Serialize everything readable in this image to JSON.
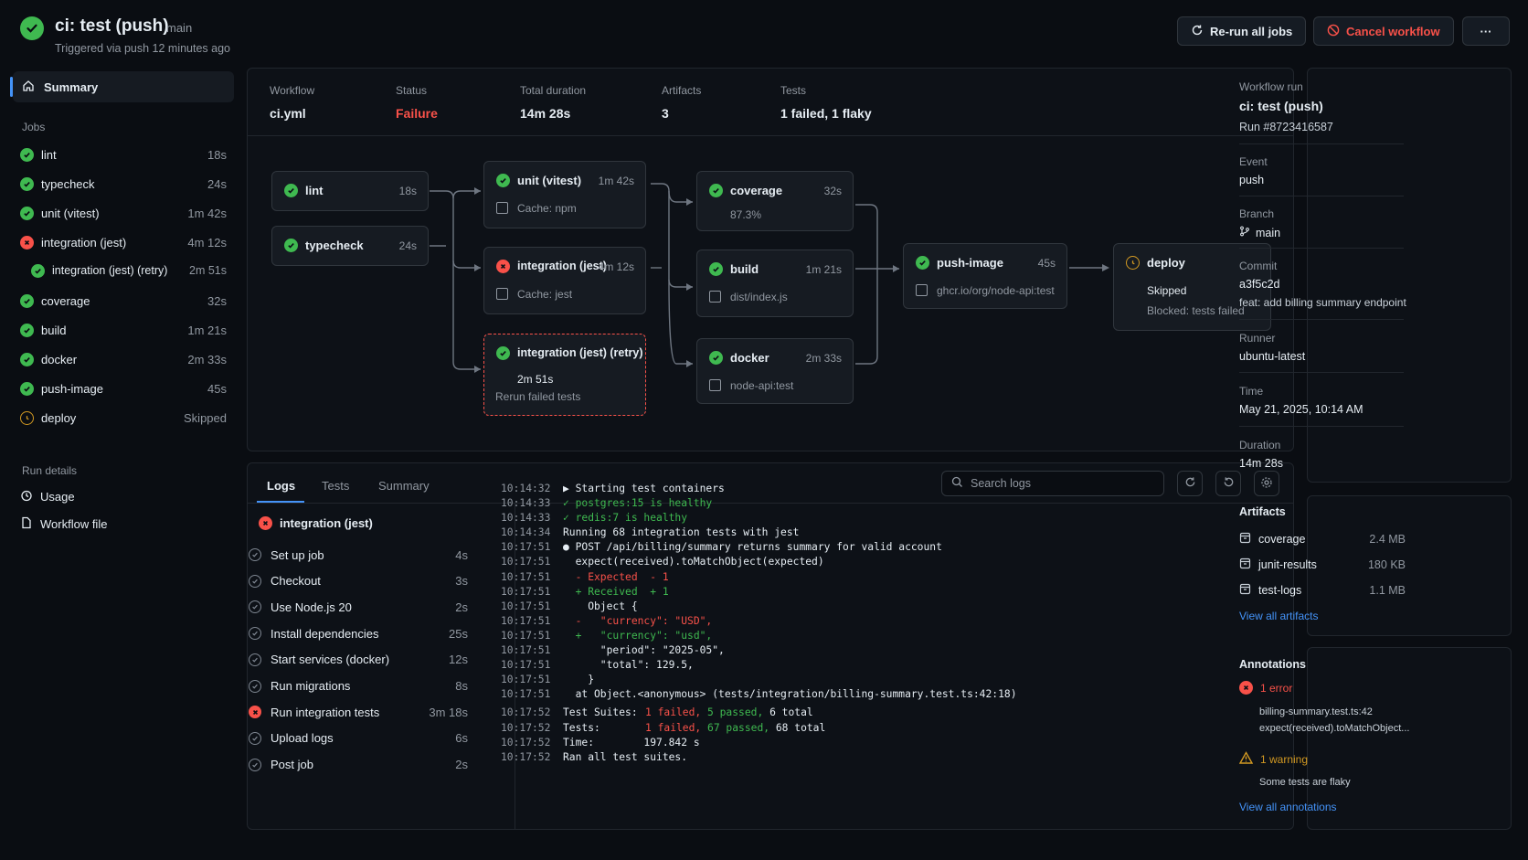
{
  "header": {
    "title": "ci: test (push)",
    "branch": "main",
    "subtitle": "Triggered via push 12 minutes ago",
    "rerun_label": "Re-run all jobs",
    "cancel_label": "Cancel workflow",
    "more_label": "···"
  },
  "sidebar": {
    "summary_label": "Summary",
    "jobs_heading": "Jobs",
    "jobs": [
      {
        "name": "lint",
        "duration": "18s",
        "status": "success"
      },
      {
        "name": "typecheck",
        "duration": "24s",
        "status": "success"
      },
      {
        "name": "unit (vitest)",
        "duration": "1m 42s",
        "status": "success"
      },
      {
        "name": "integration (jest)",
        "duration": "4m 12s",
        "status": "failure"
      },
      {
        "name": "integration (jest) (retry)",
        "duration": "2m 51s",
        "status": "success"
      },
      {
        "name": "coverage",
        "duration": "32s",
        "status": "success"
      },
      {
        "name": "build",
        "duration": "1m 21s",
        "status": "success"
      },
      {
        "name": "docker",
        "duration": "2m 33s",
        "status": "success"
      },
      {
        "name": "push-image",
        "duration": "45s",
        "status": "success"
      },
      {
        "name": "deploy",
        "duration": "Skipped",
        "status": "skipped"
      }
    ],
    "run_details_heading": "Run details",
    "usage_label": "Usage",
    "workflow_file_label": "Workflow file"
  },
  "stats": {
    "workflow_label": "Workflow",
    "workflow_value": "ci.yml",
    "status_label": "Status",
    "status_value": "Failure",
    "duration_label": "Total duration",
    "duration_value": "14m 28s",
    "artifacts_label": "Artifacts",
    "artifacts_value": "3",
    "tests_label": "Tests",
    "tests_value": "1 failed, 1 flaky"
  },
  "graph": {
    "lint": {
      "name": "lint",
      "duration": "18s"
    },
    "typecheck": {
      "name": "typecheck",
      "duration": "24s"
    },
    "unit": {
      "name": "unit (vitest)",
      "duration": "1m 42s",
      "sub": "Cache: npm"
    },
    "integration": {
      "name": "integration (jest)",
      "duration": "4m 12s",
      "sub": "Cache: jest"
    },
    "retry": {
      "name": "integration (jest) (retry)",
      "duration": "2m 51s",
      "sub": "Rerun failed tests"
    },
    "coverage": {
      "name": "coverage",
      "duration": "32s",
      "sub": "87.3%"
    },
    "build": {
      "name": "build",
      "duration": "1m 21s",
      "sub": "dist/index.js"
    },
    "docker": {
      "name": "docker",
      "duration": "2m 33s",
      "sub": "node-api:test"
    },
    "push_image": {
      "name": "push-image",
      "duration": "45s",
      "sub": "ghcr.io/org/node-api:test"
    },
    "deploy": {
      "name": "deploy",
      "sub": "Skipped",
      "note": "Blocked: tests failed"
    }
  },
  "logs": {
    "tabs": [
      "Logs",
      "Tests",
      "Summary"
    ],
    "search_placeholder": "Search logs",
    "job_title": "integration (jest)",
    "steps": [
      {
        "name": "Set up job",
        "duration": "4s",
        "status": "success"
      },
      {
        "name": "Checkout",
        "duration": "3s",
        "status": "success"
      },
      {
        "name": "Use Node.js 20",
        "duration": "2s",
        "status": "success"
      },
      {
        "name": "Install dependencies",
        "duration": "25s",
        "status": "success"
      },
      {
        "name": "Start services (docker)",
        "duration": "12s",
        "status": "success"
      },
      {
        "name": "Run migrations",
        "duration": "8s",
        "status": "success"
      },
      {
        "name": "Run integration tests",
        "duration": "3m 18s",
        "status": "failure"
      },
      {
        "name": "Upload logs",
        "duration": "6s",
        "status": "success"
      },
      {
        "name": "Post job",
        "duration": "2s",
        "status": "success"
      }
    ],
    "lines": [
      {
        "ts": "10:14:32",
        "text": "▶ Starting test containers",
        "color": "#e6edf3"
      },
      {
        "ts": "10:14:33",
        "text": "✓ postgres:15 is healthy",
        "color": "#3fb950"
      },
      {
        "ts": "10:14:33",
        "text": "✓ redis:7 is healthy",
        "color": "#3fb950"
      },
      {
        "ts": "10:14:34",
        "text": "Running 68 integration tests with jest",
        "color": "#e6edf3"
      },
      {
        "ts": "10:17:51",
        "text": "● POST /api/billing/summary returns summary for valid account",
        "color": "#e6edf3"
      },
      {
        "ts": "10:17:51",
        "text": "  expect(received).toMatchObject(expected)",
        "color": "#e6edf3"
      },
      {
        "ts": "10:17:51",
        "text": "  - Expected  - 1",
        "color": "#f85149"
      },
      {
        "ts": "10:17:51",
        "text": "  + Received  + 1",
        "color": "#3fb950"
      },
      {
        "ts": "10:17:51",
        "text": "    Object {",
        "color": "#e6edf3"
      },
      {
        "ts": "10:17:51",
        "text": "  -   \"currency\": \"USD\",",
        "color": "#f85149"
      },
      {
        "ts": "10:17:51",
        "text": "  +   \"currency\": \"usd\",",
        "color": "#3fb950"
      },
      {
        "ts": "10:17:51",
        "text": "      \"period\": \"2025-05\",",
        "color": "#e6edf3"
      },
      {
        "ts": "10:17:51",
        "text": "      \"total\": 129.5,",
        "color": "#e6edf3"
      },
      {
        "ts": "10:17:51",
        "text": "    }",
        "color": "#e6edf3"
      },
      {
        "ts": "10:17:51",
        "text": "  at Object.<anonymous> (tests/integration/billing-summary.test.ts:42:18)",
        "color": "#e6edf3"
      }
    ],
    "summary_lines": [
      {
        "ts": "10:17:52",
        "label": "Test Suites:",
        "failed": "1 failed,",
        "passed": "5 passed,",
        "total": "6 total"
      },
      {
        "ts": "10:17:52",
        "label": "Tests:",
        "failed": "1 failed,",
        "passed": "67 passed,",
        "total": "68 total"
      }
    ],
    "time_line": {
      "ts": "10:17:52",
      "text": "Time:        197.842 s"
    },
    "ran_line": {
      "ts": "10:17:52",
      "text": "Ran all test suites."
    }
  },
  "run_panel": {
    "heading": "Workflow run",
    "name": "ci: test (push)",
    "run_id": "Run #8723416587",
    "event_label": "Event",
    "event_value": "push",
    "branch_label": "Branch",
    "branch_value": "main",
    "commit_label": "Commit",
    "commit_sha": "a3f5c2d",
    "commit_msg": "feat: add billing summary endpoint",
    "runner_label": "Runner",
    "runner_value": "ubuntu-latest",
    "time_label": "Time",
    "time_value": "May 21, 2025, 10:14 AM",
    "duration_label": "Duration",
    "duration_value": "14m 28s"
  },
  "artifacts": {
    "heading": "Artifacts",
    "items": [
      {
        "name": "coverage",
        "size": "2.4 MB"
      },
      {
        "name": "junit-results",
        "size": "180 KB"
      },
      {
        "name": "test-logs",
        "size": "1.1 MB"
      }
    ],
    "view_all": "View all artifacts"
  },
  "annotations": {
    "heading": "Annotations",
    "error_label": "1 error",
    "error_file": "billing-summary.test.ts:42",
    "error_msg": "expect(received).toMatchObject...",
    "warning_label": "1 warning",
    "warning_msg": "Some tests are flaky",
    "view_all": "View all annotations"
  },
  "colors": {
    "success": "#3fb950",
    "failure": "#f85149",
    "warning": "#d29922",
    "link": "#4493f8"
  }
}
